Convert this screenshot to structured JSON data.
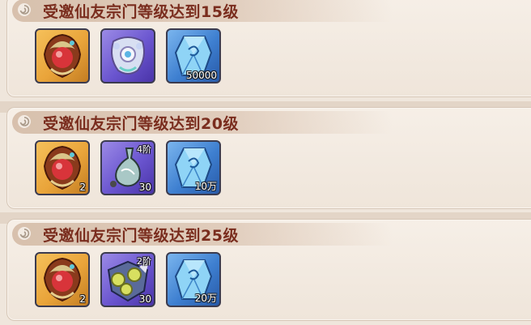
{
  "rewards": [
    {
      "title": "受邀仙友宗门等级达到15级",
      "items": [
        {
          "icon": "fire-crest-emblem-icon",
          "rarity": "gold",
          "count": "",
          "stage": ""
        },
        {
          "icon": "jade-pendant-icon",
          "rarity": "purple",
          "count": "",
          "stage": ""
        },
        {
          "icon": "spirit-stone-icon",
          "rarity": "blue",
          "count": "50000",
          "stage": ""
        }
      ]
    },
    {
      "title": "受邀仙友宗门等级达到20级",
      "items": [
        {
          "icon": "fire-crest-emblem-icon",
          "rarity": "gold",
          "count": "2",
          "stage": ""
        },
        {
          "icon": "spirit-gourd-icon",
          "rarity": "purple",
          "count": "30",
          "stage": "4阶"
        },
        {
          "icon": "spirit-stone-icon",
          "rarity": "blue",
          "count": "10万",
          "stage": ""
        }
      ]
    },
    {
      "title": "受邀仙友宗门等级达到25级",
      "items": [
        {
          "icon": "fire-crest-emblem-icon",
          "rarity": "gold",
          "count": "2",
          "stage": ""
        },
        {
          "icon": "beast-core-icon",
          "rarity": "purple",
          "count": "30",
          "stage": "2阶"
        },
        {
          "icon": "spirit-stone-icon",
          "rarity": "blue",
          "count": "20万",
          "stage": ""
        }
      ]
    }
  ],
  "colors": {
    "title": "#7a2d1e",
    "gold": "#e9a43a",
    "purple": "#6a55cf",
    "blue": "#3e7fd0"
  }
}
